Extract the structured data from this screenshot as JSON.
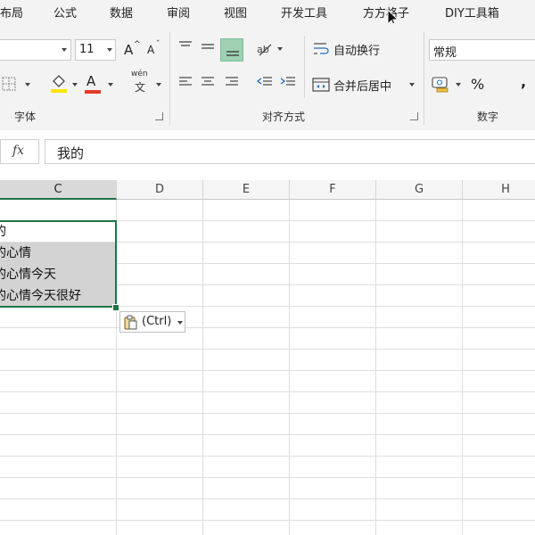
{
  "menu": {
    "items": [
      "布局",
      "公式",
      "数据",
      "审阅",
      "视图",
      "开发工具",
      "方方格子",
      "DIY工具箱"
    ]
  },
  "ribbon": {
    "font_group": {
      "font_size": "11",
      "grow_label": "A",
      "shrink_label": "A",
      "phonetic_top": "wén",
      "phonetic_bottom": "文",
      "font_color_label": "A",
      "group_label": "字体"
    },
    "alignment_group": {
      "wrap_text": "自动换行",
      "merge_center": "合并后居中",
      "group_label": "对齐方式"
    },
    "number_group": {
      "format": "常规",
      "percent": "%",
      "comma": ",",
      "group_label": "数字"
    },
    "colors": {
      "fill": "#ffe600",
      "font": "#e23d28",
      "accent": "#217346"
    }
  },
  "formula_bar": {
    "fx_label": "fx",
    "value": "我的"
  },
  "grid": {
    "columns": [
      "C",
      "D",
      "E",
      "F",
      "G",
      "H"
    ],
    "selected_column": "C",
    "cells": [
      "的",
      "的心情",
      "的心情今天",
      "的心情今天很好"
    ]
  },
  "paste_options": {
    "label": "(Ctrl)"
  }
}
